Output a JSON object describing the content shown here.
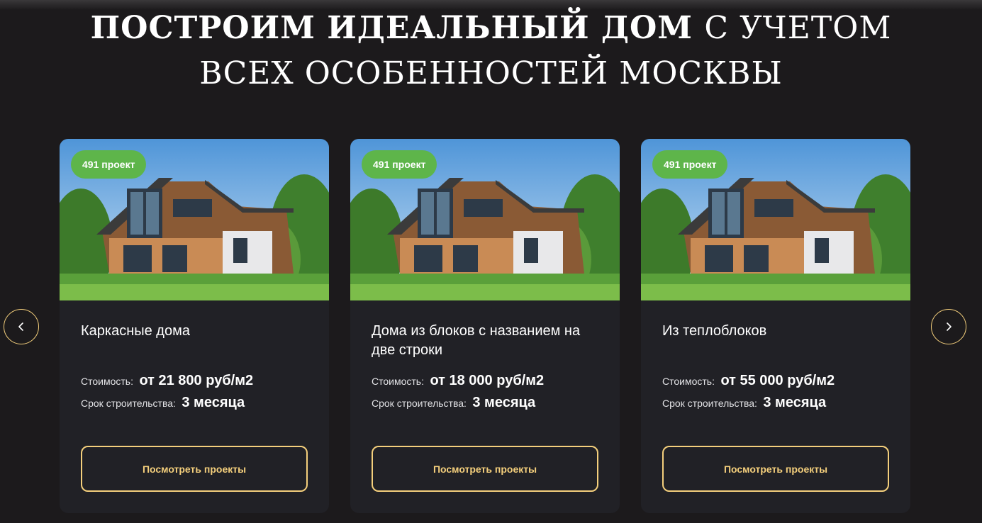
{
  "headline": {
    "bold": "ПОСТРОИМ ИДЕАЛЬНЫЙ ДОМ",
    "light_line1": "С УЧЕТОМ",
    "light_line2": "ВСЕХ ОСОБЕННОСТЕЙ МОСКВЫ"
  },
  "carousel": {
    "prev_icon": "chevron-left-icon",
    "next_icon": "chevron-right-icon",
    "accent_color": "#f4cf7c"
  },
  "cards": [
    {
      "badge": "491 проект",
      "title": "Каркасные дома",
      "price_label": "Стоимость:",
      "price_value": "от 21 800 руб/м2",
      "term_label": "Срок строительства:",
      "term_value": "3 месяца",
      "button_label": "Посмотреть проекты"
    },
    {
      "badge": "491 проект",
      "title": "Дома из блоков с названием на две строки",
      "price_label": "Стоимость:",
      "price_value": "от 18 000 руб/м2",
      "term_label": "Срок строительства:",
      "term_value": "3 месяца",
      "button_label": "Посмотреть проекты"
    },
    {
      "badge": "491 проект",
      "title": "Из теплоблоков",
      "price_label": "Стоимость:",
      "price_value": "от 55 000 руб/м2",
      "term_label": "Срок строительства:",
      "term_value": "3 месяца",
      "button_label": "Посмотреть проекты"
    }
  ],
  "colors": {
    "background": "#1c1a1c",
    "card": "#212126",
    "badge": "#5eb54a",
    "accent": "#f4cf7c"
  }
}
